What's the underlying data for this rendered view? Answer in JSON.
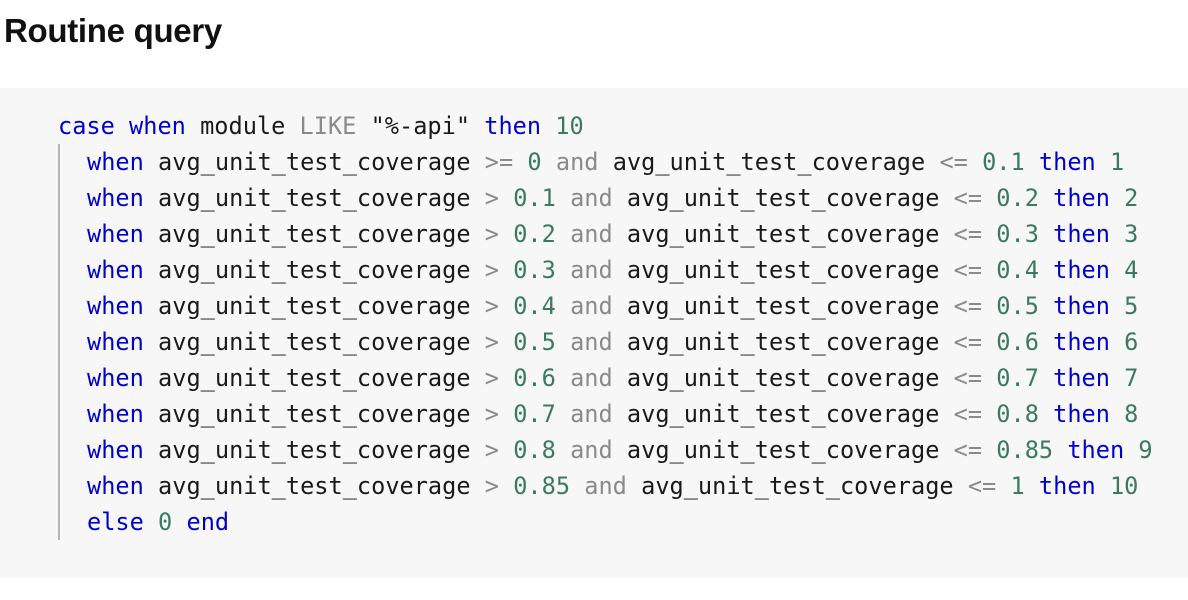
{
  "page": {
    "title": "Routine query"
  },
  "code": {
    "lines": [
      {
        "indent": false,
        "tokens": [
          {
            "t": "kw",
            "v": "case"
          },
          {
            "t": "sp",
            "v": " "
          },
          {
            "t": "kw",
            "v": "when"
          },
          {
            "t": "sp",
            "v": " "
          },
          {
            "t": "id",
            "v": "module"
          },
          {
            "t": "sp",
            "v": " "
          },
          {
            "t": "op",
            "v": "LIKE"
          },
          {
            "t": "sp",
            "v": " "
          },
          {
            "t": "str",
            "v": "\"%-api\""
          },
          {
            "t": "sp",
            "v": " "
          },
          {
            "t": "kw",
            "v": "then"
          },
          {
            "t": "sp",
            "v": " "
          },
          {
            "t": "num",
            "v": "10"
          }
        ]
      },
      {
        "indent": true,
        "tokens": [
          {
            "t": "kw",
            "v": "when"
          },
          {
            "t": "sp",
            "v": " "
          },
          {
            "t": "id",
            "v": "avg_unit_test_coverage"
          },
          {
            "t": "sp",
            "v": " "
          },
          {
            "t": "op",
            "v": ">="
          },
          {
            "t": "sp",
            "v": " "
          },
          {
            "t": "num",
            "v": "0"
          },
          {
            "t": "sp",
            "v": " "
          },
          {
            "t": "op",
            "v": "and"
          },
          {
            "t": "sp",
            "v": " "
          },
          {
            "t": "id",
            "v": "avg_unit_test_coverage"
          },
          {
            "t": "sp",
            "v": " "
          },
          {
            "t": "op",
            "v": "<="
          },
          {
            "t": "sp",
            "v": " "
          },
          {
            "t": "num",
            "v": "0.1"
          },
          {
            "t": "sp",
            "v": " "
          },
          {
            "t": "kw",
            "v": "then"
          },
          {
            "t": "sp",
            "v": " "
          },
          {
            "t": "num",
            "v": "1"
          }
        ]
      },
      {
        "indent": true,
        "tokens": [
          {
            "t": "kw",
            "v": "when"
          },
          {
            "t": "sp",
            "v": " "
          },
          {
            "t": "id",
            "v": "avg_unit_test_coverage"
          },
          {
            "t": "sp",
            "v": " "
          },
          {
            "t": "op",
            "v": ">"
          },
          {
            "t": "sp",
            "v": " "
          },
          {
            "t": "num",
            "v": "0.1"
          },
          {
            "t": "sp",
            "v": " "
          },
          {
            "t": "op",
            "v": "and"
          },
          {
            "t": "sp",
            "v": " "
          },
          {
            "t": "id",
            "v": "avg_unit_test_coverage"
          },
          {
            "t": "sp",
            "v": " "
          },
          {
            "t": "op",
            "v": "<="
          },
          {
            "t": "sp",
            "v": " "
          },
          {
            "t": "num",
            "v": "0.2"
          },
          {
            "t": "sp",
            "v": " "
          },
          {
            "t": "kw",
            "v": "then"
          },
          {
            "t": "sp",
            "v": " "
          },
          {
            "t": "num",
            "v": "2"
          }
        ]
      },
      {
        "indent": true,
        "tokens": [
          {
            "t": "kw",
            "v": "when"
          },
          {
            "t": "sp",
            "v": " "
          },
          {
            "t": "id",
            "v": "avg_unit_test_coverage"
          },
          {
            "t": "sp",
            "v": " "
          },
          {
            "t": "op",
            "v": ">"
          },
          {
            "t": "sp",
            "v": " "
          },
          {
            "t": "num",
            "v": "0.2"
          },
          {
            "t": "sp",
            "v": " "
          },
          {
            "t": "op",
            "v": "and"
          },
          {
            "t": "sp",
            "v": " "
          },
          {
            "t": "id",
            "v": "avg_unit_test_coverage"
          },
          {
            "t": "sp",
            "v": " "
          },
          {
            "t": "op",
            "v": "<="
          },
          {
            "t": "sp",
            "v": " "
          },
          {
            "t": "num",
            "v": "0.3"
          },
          {
            "t": "sp",
            "v": " "
          },
          {
            "t": "kw",
            "v": "then"
          },
          {
            "t": "sp",
            "v": " "
          },
          {
            "t": "num",
            "v": "3"
          }
        ]
      },
      {
        "indent": true,
        "tokens": [
          {
            "t": "kw",
            "v": "when"
          },
          {
            "t": "sp",
            "v": " "
          },
          {
            "t": "id",
            "v": "avg_unit_test_coverage"
          },
          {
            "t": "sp",
            "v": " "
          },
          {
            "t": "op",
            "v": ">"
          },
          {
            "t": "sp",
            "v": " "
          },
          {
            "t": "num",
            "v": "0.3"
          },
          {
            "t": "sp",
            "v": " "
          },
          {
            "t": "op",
            "v": "and"
          },
          {
            "t": "sp",
            "v": " "
          },
          {
            "t": "id",
            "v": "avg_unit_test_coverage"
          },
          {
            "t": "sp",
            "v": " "
          },
          {
            "t": "op",
            "v": "<="
          },
          {
            "t": "sp",
            "v": " "
          },
          {
            "t": "num",
            "v": "0.4"
          },
          {
            "t": "sp",
            "v": " "
          },
          {
            "t": "kw",
            "v": "then"
          },
          {
            "t": "sp",
            "v": " "
          },
          {
            "t": "num",
            "v": "4"
          }
        ]
      },
      {
        "indent": true,
        "tokens": [
          {
            "t": "kw",
            "v": "when"
          },
          {
            "t": "sp",
            "v": " "
          },
          {
            "t": "id",
            "v": "avg_unit_test_coverage"
          },
          {
            "t": "sp",
            "v": " "
          },
          {
            "t": "op",
            "v": ">"
          },
          {
            "t": "sp",
            "v": " "
          },
          {
            "t": "num",
            "v": "0.4"
          },
          {
            "t": "sp",
            "v": " "
          },
          {
            "t": "op",
            "v": "and"
          },
          {
            "t": "sp",
            "v": " "
          },
          {
            "t": "id",
            "v": "avg_unit_test_coverage"
          },
          {
            "t": "sp",
            "v": " "
          },
          {
            "t": "op",
            "v": "<="
          },
          {
            "t": "sp",
            "v": " "
          },
          {
            "t": "num",
            "v": "0.5"
          },
          {
            "t": "sp",
            "v": " "
          },
          {
            "t": "kw",
            "v": "then"
          },
          {
            "t": "sp",
            "v": " "
          },
          {
            "t": "num",
            "v": "5"
          }
        ]
      },
      {
        "indent": true,
        "tokens": [
          {
            "t": "kw",
            "v": "when"
          },
          {
            "t": "sp",
            "v": " "
          },
          {
            "t": "id",
            "v": "avg_unit_test_coverage"
          },
          {
            "t": "sp",
            "v": " "
          },
          {
            "t": "op",
            "v": ">"
          },
          {
            "t": "sp",
            "v": " "
          },
          {
            "t": "num",
            "v": "0.5"
          },
          {
            "t": "sp",
            "v": " "
          },
          {
            "t": "op",
            "v": "and"
          },
          {
            "t": "sp",
            "v": " "
          },
          {
            "t": "id",
            "v": "avg_unit_test_coverage"
          },
          {
            "t": "sp",
            "v": " "
          },
          {
            "t": "op",
            "v": "<="
          },
          {
            "t": "sp",
            "v": " "
          },
          {
            "t": "num",
            "v": "0.6"
          },
          {
            "t": "sp",
            "v": " "
          },
          {
            "t": "kw",
            "v": "then"
          },
          {
            "t": "sp",
            "v": " "
          },
          {
            "t": "num",
            "v": "6"
          }
        ]
      },
      {
        "indent": true,
        "tokens": [
          {
            "t": "kw",
            "v": "when"
          },
          {
            "t": "sp",
            "v": " "
          },
          {
            "t": "id",
            "v": "avg_unit_test_coverage"
          },
          {
            "t": "sp",
            "v": " "
          },
          {
            "t": "op",
            "v": ">"
          },
          {
            "t": "sp",
            "v": " "
          },
          {
            "t": "num",
            "v": "0.6"
          },
          {
            "t": "sp",
            "v": " "
          },
          {
            "t": "op",
            "v": "and"
          },
          {
            "t": "sp",
            "v": " "
          },
          {
            "t": "id",
            "v": "avg_unit_test_coverage"
          },
          {
            "t": "sp",
            "v": " "
          },
          {
            "t": "op",
            "v": "<="
          },
          {
            "t": "sp",
            "v": " "
          },
          {
            "t": "num",
            "v": "0.7"
          },
          {
            "t": "sp",
            "v": " "
          },
          {
            "t": "kw",
            "v": "then"
          },
          {
            "t": "sp",
            "v": " "
          },
          {
            "t": "num",
            "v": "7"
          }
        ]
      },
      {
        "indent": true,
        "tokens": [
          {
            "t": "kw",
            "v": "when"
          },
          {
            "t": "sp",
            "v": " "
          },
          {
            "t": "id",
            "v": "avg_unit_test_coverage"
          },
          {
            "t": "sp",
            "v": " "
          },
          {
            "t": "op",
            "v": ">"
          },
          {
            "t": "sp",
            "v": " "
          },
          {
            "t": "num",
            "v": "0.7"
          },
          {
            "t": "sp",
            "v": " "
          },
          {
            "t": "op",
            "v": "and"
          },
          {
            "t": "sp",
            "v": " "
          },
          {
            "t": "id",
            "v": "avg_unit_test_coverage"
          },
          {
            "t": "sp",
            "v": " "
          },
          {
            "t": "op",
            "v": "<="
          },
          {
            "t": "sp",
            "v": " "
          },
          {
            "t": "num",
            "v": "0.8"
          },
          {
            "t": "sp",
            "v": " "
          },
          {
            "t": "kw",
            "v": "then"
          },
          {
            "t": "sp",
            "v": " "
          },
          {
            "t": "num",
            "v": "8"
          }
        ]
      },
      {
        "indent": true,
        "tokens": [
          {
            "t": "kw",
            "v": "when"
          },
          {
            "t": "sp",
            "v": " "
          },
          {
            "t": "id",
            "v": "avg_unit_test_coverage"
          },
          {
            "t": "sp",
            "v": " "
          },
          {
            "t": "op",
            "v": ">"
          },
          {
            "t": "sp",
            "v": " "
          },
          {
            "t": "num",
            "v": "0.8"
          },
          {
            "t": "sp",
            "v": " "
          },
          {
            "t": "op",
            "v": "and"
          },
          {
            "t": "sp",
            "v": " "
          },
          {
            "t": "id",
            "v": "avg_unit_test_coverage"
          },
          {
            "t": "sp",
            "v": " "
          },
          {
            "t": "op",
            "v": "<="
          },
          {
            "t": "sp",
            "v": " "
          },
          {
            "t": "num",
            "v": "0.85"
          },
          {
            "t": "sp",
            "v": " "
          },
          {
            "t": "kw",
            "v": "then"
          },
          {
            "t": "sp",
            "v": " "
          },
          {
            "t": "num",
            "v": "9"
          }
        ]
      },
      {
        "indent": true,
        "tokens": [
          {
            "t": "kw",
            "v": "when"
          },
          {
            "t": "sp",
            "v": " "
          },
          {
            "t": "id",
            "v": "avg_unit_test_coverage"
          },
          {
            "t": "sp",
            "v": " "
          },
          {
            "t": "op",
            "v": ">"
          },
          {
            "t": "sp",
            "v": " "
          },
          {
            "t": "num",
            "v": "0.85"
          },
          {
            "t": "sp",
            "v": " "
          },
          {
            "t": "op",
            "v": "and"
          },
          {
            "t": "sp",
            "v": " "
          },
          {
            "t": "id",
            "v": "avg_unit_test_coverage"
          },
          {
            "t": "sp",
            "v": " "
          },
          {
            "t": "op",
            "v": "<="
          },
          {
            "t": "sp",
            "v": " "
          },
          {
            "t": "num",
            "v": "1"
          },
          {
            "t": "sp",
            "v": " "
          },
          {
            "t": "kw",
            "v": "then"
          },
          {
            "t": "sp",
            "v": " "
          },
          {
            "t": "num",
            "v": "10"
          }
        ]
      },
      {
        "indent": true,
        "tokens": [
          {
            "t": "kw",
            "v": "else"
          },
          {
            "t": "sp",
            "v": " "
          },
          {
            "t": "num",
            "v": "0"
          },
          {
            "t": "sp",
            "v": " "
          },
          {
            "t": "kw",
            "v": "end"
          }
        ]
      }
    ]
  },
  "colors": {
    "keyword": "#0000cc",
    "number": "#3a7a5e",
    "operator": "#8a8a8a",
    "identifier": "#1a1a1a",
    "code_background": "#f7f7f7",
    "indent_guide": "#b5b5b5"
  }
}
